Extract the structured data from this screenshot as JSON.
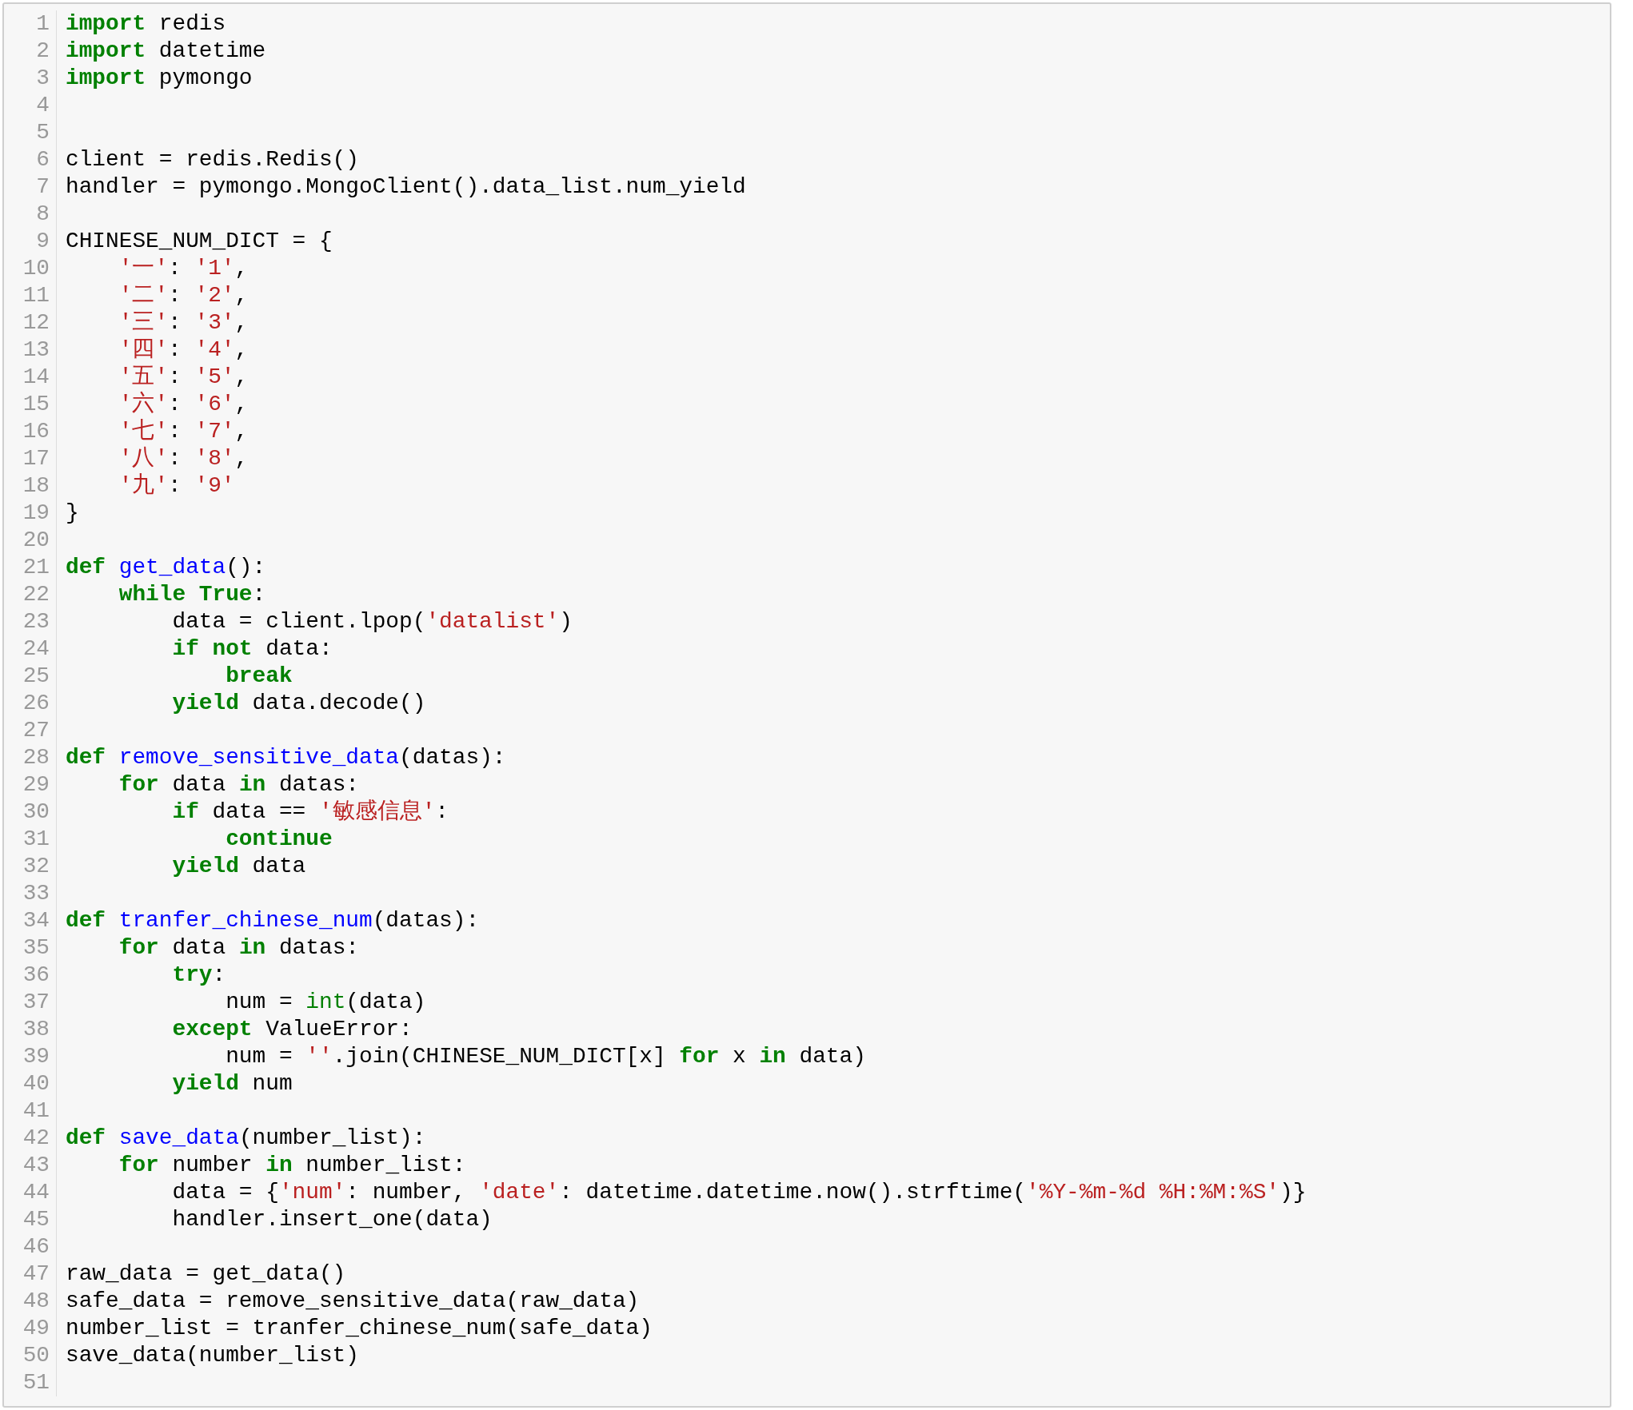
{
  "editor": {
    "lines": [
      {
        "number": "1",
        "tokens": [
          {
            "kind": "keyword",
            "text": "import"
          },
          {
            "kind": "plain",
            "text": " redis"
          }
        ]
      },
      {
        "number": "2",
        "tokens": [
          {
            "kind": "keyword",
            "text": "import"
          },
          {
            "kind": "plain",
            "text": " datetime"
          }
        ]
      },
      {
        "number": "3",
        "tokens": [
          {
            "kind": "keyword",
            "text": "import"
          },
          {
            "kind": "plain",
            "text": " pymongo"
          }
        ]
      },
      {
        "number": "4"
      },
      {
        "number": "5"
      },
      {
        "number": "6",
        "tokens": [
          {
            "kind": "plain",
            "text": "client = redis.Redis()"
          }
        ]
      },
      {
        "number": "7",
        "tokens": [
          {
            "kind": "plain",
            "text": "handler = pymongo.MongoClient().data_list.num_yield"
          }
        ]
      },
      {
        "number": "8"
      },
      {
        "number": "9",
        "tokens": [
          {
            "kind": "plain",
            "text": "CHINESE_NUM_DICT = {"
          }
        ]
      },
      {
        "number": "10",
        "tokens": [
          {
            "kind": "string",
            "text": "    '一'"
          },
          {
            "kind": "plain",
            "text": ": "
          },
          {
            "kind": "string",
            "text": "'1'"
          },
          {
            "kind": "plain",
            "text": ","
          }
        ]
      },
      {
        "number": "11",
        "tokens": [
          {
            "kind": "string",
            "text": "    '二'"
          },
          {
            "kind": "plain",
            "text": ": "
          },
          {
            "kind": "string",
            "text": "'2'"
          },
          {
            "kind": "plain",
            "text": ","
          }
        ]
      },
      {
        "number": "12",
        "tokens": [
          {
            "kind": "string",
            "text": "    '三'"
          },
          {
            "kind": "plain",
            "text": ": "
          },
          {
            "kind": "string",
            "text": "'3'"
          },
          {
            "kind": "plain",
            "text": ","
          }
        ]
      },
      {
        "number": "13",
        "tokens": [
          {
            "kind": "string",
            "text": "    '四'"
          },
          {
            "kind": "plain",
            "text": ": "
          },
          {
            "kind": "string",
            "text": "'4'"
          },
          {
            "kind": "plain",
            "text": ","
          }
        ]
      },
      {
        "number": "14",
        "tokens": [
          {
            "kind": "string",
            "text": "    '五'"
          },
          {
            "kind": "plain",
            "text": ": "
          },
          {
            "kind": "string",
            "text": "'5'"
          },
          {
            "kind": "plain",
            "text": ","
          }
        ]
      },
      {
        "number": "15",
        "tokens": [
          {
            "kind": "string",
            "text": "    '六'"
          },
          {
            "kind": "plain",
            "text": ": "
          },
          {
            "kind": "string",
            "text": "'6'"
          },
          {
            "kind": "plain",
            "text": ","
          }
        ]
      },
      {
        "number": "16",
        "tokens": [
          {
            "kind": "string",
            "text": "    '七'"
          },
          {
            "kind": "plain",
            "text": ": "
          },
          {
            "kind": "string",
            "text": "'7'"
          },
          {
            "kind": "plain",
            "text": ","
          }
        ]
      },
      {
        "number": "17",
        "tokens": [
          {
            "kind": "string",
            "text": "    '八'"
          },
          {
            "kind": "plain",
            "text": ": "
          },
          {
            "kind": "string",
            "text": "'8'"
          },
          {
            "kind": "plain",
            "text": ","
          }
        ]
      },
      {
        "number": "18",
        "tokens": [
          {
            "kind": "string",
            "text": "    '九'"
          },
          {
            "kind": "plain",
            "text": ": "
          },
          {
            "kind": "string",
            "text": "'9'"
          }
        ]
      },
      {
        "number": "19",
        "tokens": [
          {
            "kind": "plain",
            "text": "}"
          }
        ]
      },
      {
        "number": "20"
      },
      {
        "number": "21",
        "tokens": [
          {
            "kind": "keyword",
            "text": "def "
          },
          {
            "kind": "function",
            "text": "get_data"
          },
          {
            "kind": "plain",
            "text": "():"
          }
        ]
      },
      {
        "number": "22",
        "tokens": [
          {
            "kind": "keyword",
            "text": "    while "
          },
          {
            "kind": "keyword",
            "text": "True"
          },
          {
            "kind": "plain",
            "text": ":"
          }
        ]
      },
      {
        "number": "23",
        "tokens": [
          {
            "kind": "plain",
            "text": "        data = client.lpop("
          },
          {
            "kind": "string",
            "text": "'datalist'"
          },
          {
            "kind": "plain",
            "text": ")"
          }
        ]
      },
      {
        "number": "24",
        "tokens": [
          {
            "kind": "keyword",
            "text": "        if not"
          },
          {
            "kind": "plain",
            "text": " data:"
          }
        ]
      },
      {
        "number": "25",
        "tokens": [
          {
            "kind": "keyword",
            "text": "            break"
          }
        ]
      },
      {
        "number": "26",
        "tokens": [
          {
            "kind": "keyword",
            "text": "        yield"
          },
          {
            "kind": "plain",
            "text": " data.decode()"
          }
        ]
      },
      {
        "number": "27"
      },
      {
        "number": "28",
        "tokens": [
          {
            "kind": "keyword",
            "text": "def "
          },
          {
            "kind": "function",
            "text": "remove_sensitive_data"
          },
          {
            "kind": "plain",
            "text": "(datas):"
          }
        ]
      },
      {
        "number": "29",
        "tokens": [
          {
            "kind": "keyword",
            "text": "    for"
          },
          {
            "kind": "plain",
            "text": " data "
          },
          {
            "kind": "keyword",
            "text": "in"
          },
          {
            "kind": "plain",
            "text": " datas:"
          }
        ]
      },
      {
        "number": "30",
        "tokens": [
          {
            "kind": "keyword",
            "text": "        if"
          },
          {
            "kind": "plain",
            "text": " data == "
          },
          {
            "kind": "string",
            "text": "'敏感信息'"
          },
          {
            "kind": "plain",
            "text": ":"
          }
        ]
      },
      {
        "number": "31",
        "tokens": [
          {
            "kind": "keyword",
            "text": "            continue"
          }
        ]
      },
      {
        "number": "32",
        "tokens": [
          {
            "kind": "keyword",
            "text": "        yield"
          },
          {
            "kind": "plain",
            "text": " data"
          }
        ]
      },
      {
        "number": "33"
      },
      {
        "number": "34",
        "tokens": [
          {
            "kind": "keyword",
            "text": "def "
          },
          {
            "kind": "function",
            "text": "tranfer_chinese_num"
          },
          {
            "kind": "plain",
            "text": "(datas):"
          }
        ]
      },
      {
        "number": "35",
        "tokens": [
          {
            "kind": "keyword",
            "text": "    for"
          },
          {
            "kind": "plain",
            "text": " data "
          },
          {
            "kind": "keyword",
            "text": "in"
          },
          {
            "kind": "plain",
            "text": " datas:"
          }
        ]
      },
      {
        "number": "36",
        "tokens": [
          {
            "kind": "keyword",
            "text": "        try"
          },
          {
            "kind": "plain",
            "text": ":"
          }
        ]
      },
      {
        "number": "37",
        "tokens": [
          {
            "kind": "plain",
            "text": "            num = "
          },
          {
            "kind": "builtin",
            "text": "int"
          },
          {
            "kind": "plain",
            "text": "(data)"
          }
        ]
      },
      {
        "number": "38",
        "tokens": [
          {
            "kind": "keyword",
            "text": "        except"
          },
          {
            "kind": "plain",
            "text": " ValueError:"
          }
        ]
      },
      {
        "number": "39",
        "tokens": [
          {
            "kind": "plain",
            "text": "            num = "
          },
          {
            "kind": "string",
            "text": "''"
          },
          {
            "kind": "plain",
            "text": ".join(CHINESE_NUM_DICT[x] "
          },
          {
            "kind": "keyword",
            "text": "for"
          },
          {
            "kind": "plain",
            "text": " x "
          },
          {
            "kind": "keyword",
            "text": "in"
          },
          {
            "kind": "plain",
            "text": " data)"
          }
        ]
      },
      {
        "number": "40",
        "tokens": [
          {
            "kind": "keyword",
            "text": "        yield"
          },
          {
            "kind": "plain",
            "text": " num"
          }
        ]
      },
      {
        "number": "41"
      },
      {
        "number": "42",
        "tokens": [
          {
            "kind": "keyword",
            "text": "def "
          },
          {
            "kind": "function",
            "text": "save_data"
          },
          {
            "kind": "plain",
            "text": "(number_list):"
          }
        ]
      },
      {
        "number": "43",
        "tokens": [
          {
            "kind": "keyword",
            "text": "    for"
          },
          {
            "kind": "plain",
            "text": " number "
          },
          {
            "kind": "keyword",
            "text": "in"
          },
          {
            "kind": "plain",
            "text": " number_list:"
          }
        ]
      },
      {
        "number": "44",
        "tokens": [
          {
            "kind": "plain",
            "text": "        data = {"
          },
          {
            "kind": "string",
            "text": "'num'"
          },
          {
            "kind": "plain",
            "text": ": number, "
          },
          {
            "kind": "string",
            "text": "'date'"
          },
          {
            "kind": "plain",
            "text": ": datetime.datetime.now().strftime("
          },
          {
            "kind": "string",
            "text": "'%Y-%m-%d %H:%M:%S'"
          },
          {
            "kind": "plain",
            "text": ")}"
          }
        ]
      },
      {
        "number": "45",
        "tokens": [
          {
            "kind": "plain",
            "text": "        handler.insert_one(data)"
          }
        ]
      },
      {
        "number": "46"
      },
      {
        "number": "47",
        "tokens": [
          {
            "kind": "plain",
            "text": "raw_data = get_data()"
          }
        ]
      },
      {
        "number": "48",
        "tokens": [
          {
            "kind": "plain",
            "text": "safe_data = remove_sensitive_data(raw_data)"
          }
        ]
      },
      {
        "number": "49",
        "tokens": [
          {
            "kind": "plain",
            "text": "number_list = tranfer_chinese_num(safe_data)"
          }
        ]
      },
      {
        "number": "50",
        "tokens": [
          {
            "kind": "plain",
            "text": "save_data(number_list)"
          }
        ]
      },
      {
        "number": "51"
      }
    ]
  }
}
